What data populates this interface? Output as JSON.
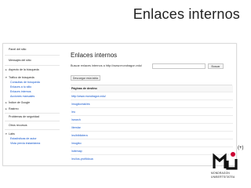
{
  "slide": {
    "title": "Enlaces internos"
  },
  "sidebar": {
    "items": [
      {
        "label": "Panel del sitio",
        "caret": "",
        "style": "plain"
      },
      {
        "label": "Mensajes del sitio",
        "caret": "",
        "style": "plain"
      },
      {
        "label": "Aspecto de la búsqueda",
        "caret": "▸",
        "style": "plain"
      },
      {
        "label": "Tráfico de búsqueda",
        "caret": "▾",
        "style": "plain"
      },
      {
        "label": "Consultas de búsqueda",
        "caret": "",
        "style": "sub"
      },
      {
        "label": "Enlaces a tu sitio",
        "caret": "",
        "style": "sub"
      },
      {
        "label": "Enlaces internos",
        "caret": "",
        "style": "active"
      },
      {
        "label": "Acciones manuales",
        "caret": "",
        "style": "sub"
      },
      {
        "label": "Índice de Google",
        "caret": "▸",
        "style": "plain"
      },
      {
        "label": "Rastreo",
        "caret": "▸",
        "style": "plain"
      },
      {
        "label": "Problemas de seguridad",
        "caret": "",
        "style": "plain"
      },
      {
        "label": "Otros recursos",
        "caret": "",
        "style": "plain"
      },
      {
        "label": "Labs",
        "caret": "▾",
        "style": "plain"
      },
      {
        "label": "Estadísticas de autor",
        "caret": "",
        "style": "sub"
      },
      {
        "label": "Vista previa instantánea",
        "caret": "",
        "style": "sub"
      }
    ]
  },
  "main": {
    "title": "Enlaces internos",
    "search_label": "Buscar enlaces internos a http://www.mondragon.edu/",
    "search_value": "",
    "search_button": "Buscar",
    "download_button": "Descargar esta tabla",
    "table_header": "Páginas de destino",
    "rows": [
      "http://www.mondragon.edu/",
      "/mugikorrak/es",
      "/eu",
      "/search",
      "/itemlar",
      "/eu/bibliotera",
      "/mugiko",
      "/sitemap",
      "/eu/los-profildoua"
    ]
  },
  "logo": {
    "badge": "(+)",
    "line1": "MONDRAGON",
    "line2": "UNIBERTSITATEA",
    "colors": {
      "mark": "#111111",
      "accent": "#cc0033"
    }
  }
}
